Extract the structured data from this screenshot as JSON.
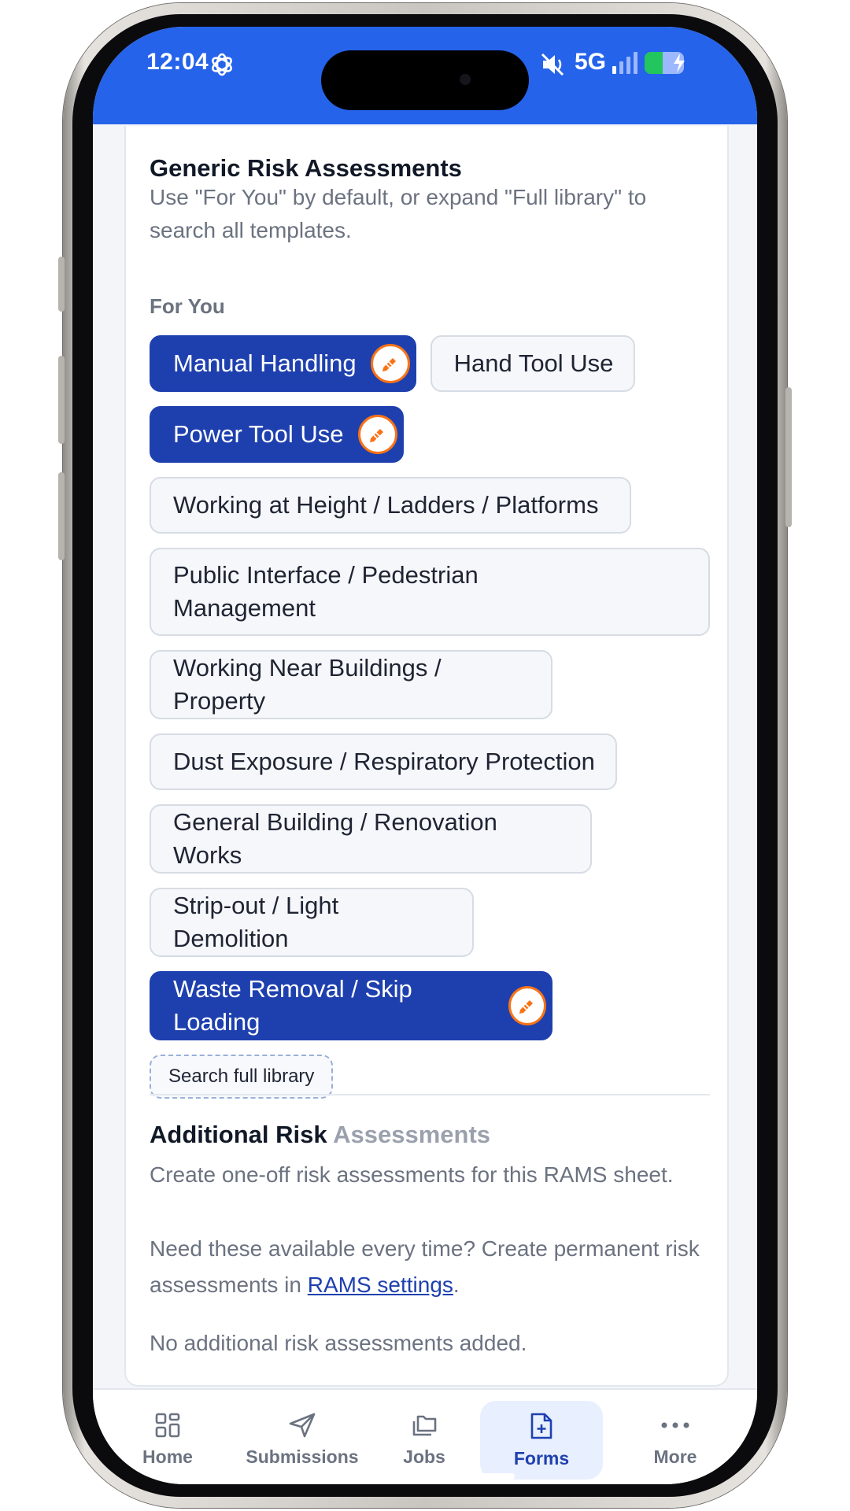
{
  "status_bar": {
    "time": "12:04",
    "network": "5G"
  },
  "generic": {
    "title": "Generic Risk Assessments",
    "description": "Use \"For You\" by default, or expand \"Full library\" to search all templates.",
    "for_you_label": "For You",
    "chips": [
      {
        "label": "Manual Handling",
        "selected": true
      },
      {
        "label": "Hand Tool Use",
        "selected": false
      },
      {
        "label": "Power Tool Use",
        "selected": true
      },
      {
        "label": "Working at Height / Ladders / Platforms",
        "selected": false
      },
      {
        "label": "Public Interface / Pedestrian Management",
        "selected": false
      },
      {
        "label": "Working Near Buildings / Property",
        "selected": false
      },
      {
        "label": "Dust Exposure / Respiratory Protection",
        "selected": false
      },
      {
        "label": "General Building / Renovation Works",
        "selected": false
      },
      {
        "label": "Strip-out / Light Demolition",
        "selected": false
      },
      {
        "label": "Waste Removal / Skip Loading",
        "selected": true
      }
    ],
    "search_full_library": "Search full library"
  },
  "additional": {
    "title_part1": "Additional Risk",
    "title_part2": "Assessments",
    "description": "Create one-off risk assessments for this RAMS sheet.",
    "permanent_prefix": "Need these available every time? Create permanent risk assessments in",
    "permanent_link": "RAMS settings",
    "permanent_suffix": ".",
    "empty_text": "No additional risk assessments added."
  },
  "bottom_nav": {
    "items": [
      {
        "label": "Home",
        "icon": "grid-icon",
        "active": false
      },
      {
        "label": "Submissions",
        "icon": "send-icon",
        "active": false
      },
      {
        "label": "Jobs",
        "icon": "folders-icon",
        "active": false
      },
      {
        "label": "Forms",
        "icon": "file-plus-icon",
        "active": true
      },
      {
        "label": "More",
        "icon": "more-dots-icon",
        "active": false
      }
    ]
  },
  "colors": {
    "header_blue": "#2563eb",
    "selected_chip": "#1e40af",
    "edit_badge_accent": "#f97316"
  }
}
